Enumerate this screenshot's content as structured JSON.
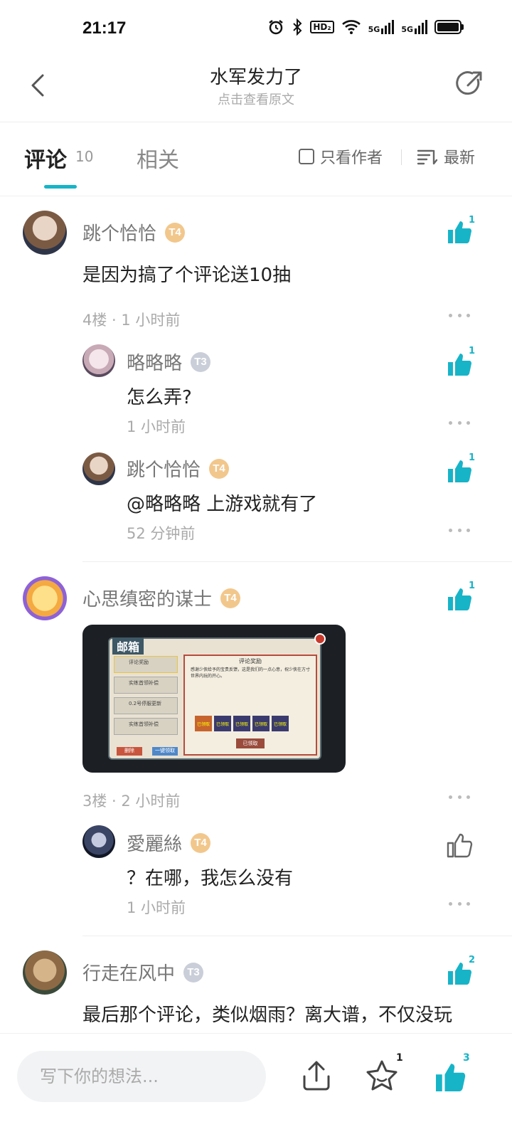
{
  "status_bar": {
    "time": "21:17",
    "icons": [
      "alarm-icon",
      "bluetooth-icon",
      "hd-icon",
      "wifi-icon",
      "5g-signal-icon",
      "5g-signal-icon",
      "battery-icon"
    ],
    "hd_label": "HD₂",
    "net_label": "5G"
  },
  "header": {
    "title": "水军发力了",
    "subtitle": "点击查看原文"
  },
  "tabs": {
    "comments_label": "评论",
    "comments_count": "10",
    "related_label": "相关",
    "only_author_label": "只看作者",
    "sort_label": "最新"
  },
  "comments": [
    {
      "name": "跳个恰恰",
      "badge": "T4",
      "text": "是因为搞了个评论送10抽",
      "meta": "4楼 · 1 小时前",
      "likes": "1",
      "replies": [
        {
          "name": "略略略",
          "badge": "T3",
          "text": "怎么弄?",
          "meta": "1 小时前",
          "likes": "1"
        },
        {
          "name": "跳个恰恰",
          "badge": "T4",
          "text": "@略略略  上游戏就有了",
          "meta": "52 分钟前",
          "likes": "1"
        }
      ]
    },
    {
      "name": "心思缜密的谋士",
      "badge": "T4",
      "image": {
        "game_panel_title": "邮箱",
        "reward_title": "评论奖励",
        "reward_text": "感谢少侠给予的宝贵反馈，这是我们的一点心意，祝少侠在方寸世界内玩的开心。",
        "claim_label": "已领取",
        "slot_label": "已领取",
        "list_items": [
          "评论奖励",
          "实练首领补偿",
          "0.2号停服更新",
          "实练首领补偿"
        ],
        "btn_left": "删除",
        "btn_right": "一键领取"
      },
      "meta": "3楼 · 2 小时前",
      "likes": "1",
      "replies": [
        {
          "name": "愛麗絲",
          "badge": "T4",
          "text": "？在哪，我怎么没有",
          "meta": "1 小时前",
          "likes": ""
        }
      ]
    },
    {
      "name": "行走在风中",
      "badge": "T3",
      "text": "最后那个评论，类似烟雨？离大谱，不仅没玩",
      "likes": "2"
    }
  ],
  "bottom_bar": {
    "input_placeholder": "写下你的想法...",
    "favorites_count": "1",
    "likes_count": "3"
  },
  "colors": {
    "accent": "#17b4c8",
    "badge_gold": "#f2c78c",
    "badge_silver": "#c9ced8"
  }
}
